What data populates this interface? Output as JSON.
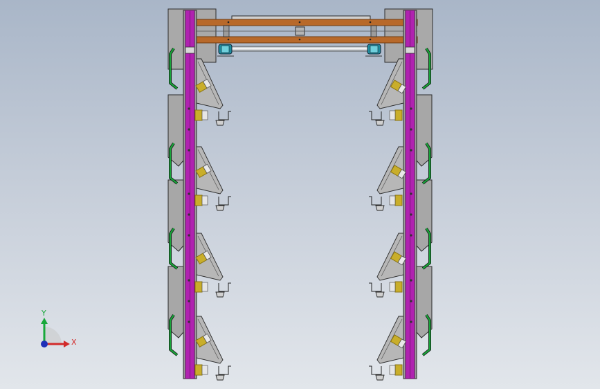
{
  "viewport": {
    "background_top": "#a9b6c8",
    "background_bottom": "#e2e6eb"
  },
  "colors": {
    "frame_plate": "#a7a7a7",
    "frame_plate_dark": "#7f7f7f",
    "outline": "#2b2b2b",
    "column": "#b022b0",
    "column_dark": "#7a127a",
    "crossbeam": "#b8692a",
    "crossbeam_dark": "#7d4415",
    "bracket": "#19a53a",
    "unit": "#c9ae2a",
    "unit_dark": "#8a7412",
    "roller": "#f2f2f2",
    "wheel": "#1f8ea0"
  },
  "triad": {
    "y_label": "Y",
    "x_label": "X",
    "y_color": "#18a83a",
    "x_color": "#d22a2a",
    "origin_color": "#1e2fb8"
  },
  "structure": {
    "tiers": 4,
    "sides": [
      "left",
      "right"
    ],
    "crossbeams": 2
  }
}
